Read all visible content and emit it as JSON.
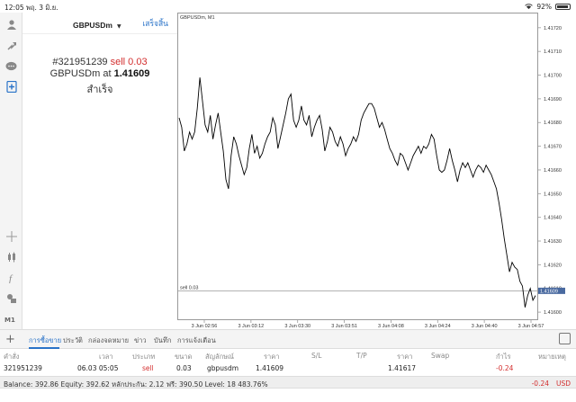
{
  "status_bar": {
    "time": "12:05",
    "date": "พฤ. 3 มิ.ย.",
    "wifi_icon": "wifi-icon",
    "battery_percent": "92%",
    "battery_level": 0.92
  },
  "order_panel": {
    "symbol": "GBPUSDm",
    "dropdown_icon": "caret-down-icon",
    "done_label": "เสร็จสิ้น",
    "ticket": "#321951239",
    "action": "sell 0.03",
    "line2_prefix": "GBPUSDm at",
    "price": "1.41609",
    "result": "สำเร็จ"
  },
  "toolbar": {
    "icons": [
      "account-icon",
      "trade-icon",
      "chat-icon",
      "new-order-icon",
      "crosshair-icon",
      "indicators-icon",
      "function-icon",
      "objects-icon"
    ],
    "timeframe": "M1"
  },
  "chart_data": {
    "type": "line",
    "symbol_label": "GBPUSDm, M1",
    "y_ticks": [
      "1.41720",
      "1.41710",
      "1.41700",
      "1.41690",
      "1.41680",
      "1.41670",
      "1.41660",
      "1.41650",
      "1.41640",
      "1.41630",
      "1.41620",
      "1.41610",
      "1.41600"
    ],
    "ylim": [
      1.41597,
      1.41726
    ],
    "x_ticks": [
      "3 Jun 02:56",
      "3 Jun 03:12",
      "3 Jun 03:30",
      "3 Jun 03:51",
      "3 Jun 04:08",
      "3 Jun 04:24",
      "3 Jun 04:40",
      "3 Jun 04:57"
    ],
    "close_values": [
      1.41682,
      1.41678,
      1.41668,
      1.41671,
      1.41676,
      1.41673,
      1.41676,
      1.41686,
      1.41699,
      1.41689,
      1.41679,
      1.41676,
      1.41683,
      1.41673,
      1.41679,
      1.41684,
      1.41676,
      1.41668,
      1.41656,
      1.41652,
      1.41666,
      1.41674,
      1.41671,
      1.41666,
      1.41662,
      1.41658,
      1.41661,
      1.41669,
      1.41675,
      1.41667,
      1.4167,
      1.41665,
      1.41667,
      1.41671,
      1.41674,
      1.41676,
      1.41682,
      1.41679,
      1.41669,
      1.41674,
      1.41679,
      1.41684,
      1.4169,
      1.41692,
      1.41681,
      1.41678,
      1.41681,
      1.41687,
      1.41681,
      1.41679,
      1.41683,
      1.41674,
      1.41678,
      1.41681,
      1.41683,
      1.41677,
      1.41668,
      1.41672,
      1.41678,
      1.41676,
      1.41672,
      1.4167,
      1.41674,
      1.41671,
      1.41666,
      1.41669,
      1.41671,
      1.41674,
      1.41672,
      1.41675,
      1.41681,
      1.41684,
      1.41686,
      1.41688,
      1.41688,
      1.41686,
      1.41682,
      1.41678,
      1.4168,
      1.41677,
      1.41673,
      1.41669,
      1.41667,
      1.41664,
      1.41662,
      1.41667,
      1.41666,
      1.41663,
      1.4166,
      1.41663,
      1.41666,
      1.41668,
      1.4167,
      1.41667,
      1.4167,
      1.41669,
      1.41671,
      1.41675,
      1.41673,
      1.41666,
      1.4166,
      1.41659,
      1.4166,
      1.41664,
      1.41669,
      1.41664,
      1.4166,
      1.41655,
      1.4166,
      1.41663,
      1.41661,
      1.41663,
      1.4166,
      1.41657,
      1.4166,
      1.41662,
      1.41661,
      1.41659,
      1.41662,
      1.4166,
      1.41658,
      1.41655,
      1.41652,
      1.41646,
      1.41639,
      1.41631,
      1.41624,
      1.41617,
      1.41621,
      1.41619,
      1.41618,
      1.41613,
      1.41611,
      1.41602,
      1.41607,
      1.4161,
      1.41605,
      1.41607
    ],
    "order_line": {
      "label": "sell 0.03",
      "price": 1.41609
    },
    "current_price": "1.41609",
    "grid": false
  },
  "tabs": {
    "add_icon": "plus-icon",
    "items": [
      "การซื้อขาย",
      "ประวัติ",
      "กล่องจดหมาย",
      "ข่าว",
      "บันทึก",
      "การแจ้งเตือน"
    ],
    "active_index": 0,
    "expand_icon": "expand-icon"
  },
  "trade_table": {
    "headers": [
      "คำสั่ง",
      "เวลา",
      "ประเภท",
      "ขนาด",
      "สัญลักษณ์",
      "ราคา",
      "S/L",
      "T/P",
      "ราคา",
      "Swap",
      "กำไร",
      "หมายเหตุ"
    ],
    "rows": [
      {
        "order": "321951239",
        "time": "06.03 05:05",
        "type": "sell",
        "size": "0.03",
        "symbol": "gbpusdm",
        "price": "1.41609",
        "sl": "",
        "tp": "",
        "current": "1.41617",
        "swap": "",
        "profit": "-0.24",
        "comment": ""
      }
    ]
  },
  "balance_bar": {
    "text": "Balance: 392.86 Equity: 392.62 หลักประกัน: 2.12 ฟรี: 390.50 Level: 18 483.76%",
    "pnl": "-0.24",
    "currency": "USD"
  },
  "colors": {
    "accent": "#2a73c8",
    "sell": "#d32f2f"
  }
}
